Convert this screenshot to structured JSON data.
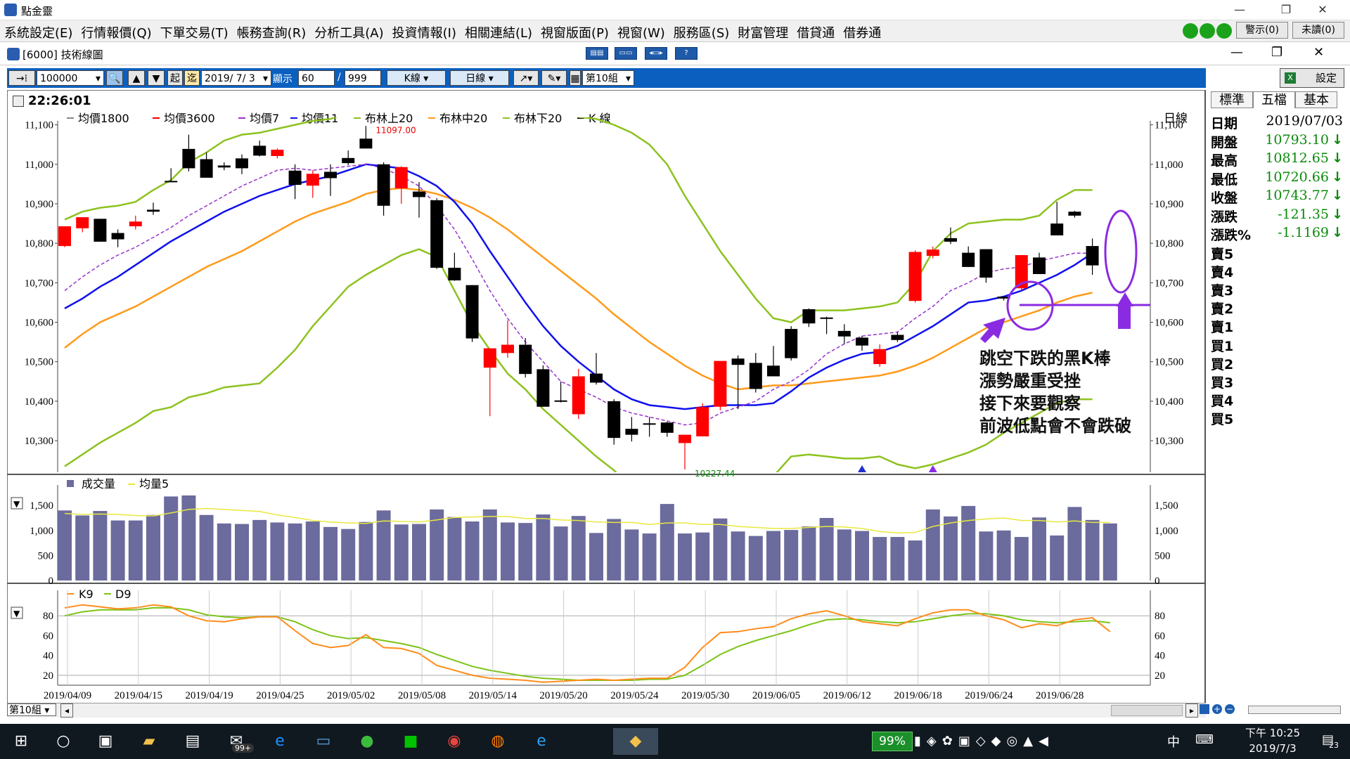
{
  "window": {
    "title": "點金靈",
    "controls": [
      "—",
      "❐",
      "✕"
    ]
  },
  "menu": {
    "items": [
      "系統設定(E)",
      "行情報價(Q)",
      "下單交易(T)",
      "帳務查詢(R)",
      "分析工具(A)",
      "投資情報(I)",
      "相關連結(L)",
      "視窗版面(P)",
      "視窗(W)",
      "服務區(S)",
      "財富管理",
      "借貸通",
      "借券通"
    ],
    "alert_btn": "警示(0)",
    "unread_btn": "未讀(0)"
  },
  "subwindow": {
    "title": "[6000] 技術線圖"
  },
  "toolbar": {
    "symbol": "100000",
    "start_label": "起",
    "end_label": "迄",
    "date": "2019/ 7/ 3",
    "show_label": "顯示",
    "show_count": "60",
    "max_count": "999",
    "kline_btn": "K線",
    "period_btn": "日線",
    "group_select": "第10組",
    "settings_btn": "設定"
  },
  "chart": {
    "time": "22:26:01",
    "period_label": "日線",
    "legend": [
      "均價1800",
      "均價3600",
      "均價7",
      "均價11",
      "布林上20",
      "布林中20",
      "布林下20",
      "K 線"
    ],
    "high_label": "11097.00",
    "low_label": "10227.44",
    "y_ticks": [
      "11,100",
      "11,000",
      "10,900",
      "10,800",
      "10,700",
      "10,600",
      "10,500",
      "10,400",
      "10,300"
    ],
    "vol_legend": [
      "成交量",
      "均量5"
    ],
    "vol_ticks": [
      "1,500",
      "1,000",
      "500",
      "0"
    ],
    "kd_legend": [
      "K9",
      "D9"
    ],
    "kd_ticks": [
      "80",
      "60",
      "40",
      "20"
    ],
    "x_labels": [
      "2019/04/09",
      "2019/04/15",
      "2019/04/19",
      "2019/04/25",
      "2019/05/02",
      "2019/05/08",
      "2019/05/14",
      "2019/05/20",
      "2019/05/24",
      "2019/05/30",
      "2019/06/05",
      "2019/06/12",
      "2019/06/18",
      "2019/06/24",
      "2019/06/28"
    ],
    "group_bottom": "第10組"
  },
  "annotation": [
    "跳空下跌的黑K棒",
    "漲勢嚴重受挫",
    "接下來要觀察",
    "前波低點會不會跌破"
  ],
  "chart_data": {
    "type": "candlestick",
    "colors": {
      "up": "#ff0000",
      "down": "#000000",
      "ma7": "#9933cc",
      "ma11": "#1010ee",
      "boll_mid": "#ff9a1a",
      "boll_band": "#8dc21f",
      "volume": "#6b6b9e",
      "vol_avg": "#e8e840",
      "k9": "#ff8c1a",
      "d9": "#7cc417"
    },
    "ohlc": [
      [
        10793,
        10812,
        10790,
        10843
      ],
      [
        10838,
        10852,
        10828,
        10866
      ],
      [
        10862,
        10855,
        10808,
        10804
      ],
      [
        10826,
        10835,
        10790,
        10810
      ],
      [
        10843,
        10870,
        10835,
        10855
      ],
      [
        10885,
        10903,
        10872,
        10880
      ],
      [
        10958,
        10990,
        10955,
        10955
      ],
      [
        11039,
        11075,
        10982,
        10990
      ],
      [
        11013,
        11030,
        10978,
        10966
      ],
      [
        10997,
        11005,
        10985,
        10992
      ],
      [
        11015,
        11025,
        10975,
        10990
      ],
      [
        11047,
        11060,
        11020,
        11022
      ],
      [
        11021,
        11040,
        11015,
        11037
      ],
      [
        10984,
        11000,
        10912,
        10948
      ],
      [
        10946,
        10985,
        10915,
        10976
      ],
      [
        10981,
        11000,
        10920,
        10965
      ],
      [
        11016,
        11035,
        10998,
        11003
      ],
      [
        11065,
        11097,
        11040,
        11040
      ],
      [
        11000,
        11005,
        10870,
        10895
      ],
      [
        10939,
        10995,
        10900,
        10993
      ],
      [
        10931,
        10955,
        10865,
        10917
      ],
      [
        10909,
        10914,
        10735,
        10738
      ],
      [
        10738,
        10776,
        10705,
        10706
      ],
      [
        10694,
        10694,
        10550,
        10559
      ],
      [
        10485,
        10525,
        10362,
        10534
      ],
      [
        10522,
        10605,
        10510,
        10543
      ],
      [
        10543,
        10560,
        10460,
        10469
      ],
      [
        10481,
        10491,
        10386,
        10386
      ],
      [
        10402,
        10450,
        10397,
        10399
      ],
      [
        10367,
        10482,
        10355,
        10463
      ],
      [
        10470,
        10522,
        10442,
        10447
      ],
      [
        10400,
        10405,
        10290,
        10307
      ],
      [
        10330,
        10360,
        10298,
        10315
      ],
      [
        10344,
        10360,
        10310,
        10343
      ],
      [
        10346,
        10348,
        10310,
        10320
      ],
      [
        10294,
        10305,
        10227,
        10315
      ],
      [
        10311,
        10395,
        10311,
        10385
      ],
      [
        10386,
        10498,
        10377,
        10502
      ],
      [
        10508,
        10516,
        10380,
        10492
      ],
      [
        10497,
        10522,
        10422,
        10431
      ],
      [
        10490,
        10540,
        10475,
        10463
      ],
      [
        10583,
        10590,
        10503,
        10509
      ],
      [
        10633,
        10635,
        10588,
        10597
      ],
      [
        10612,
        10614,
        10570,
        10609
      ],
      [
        10578,
        10595,
        10545,
        10564
      ],
      [
        10561,
        10565,
        10528,
        10541
      ],
      [
        10494,
        10544,
        10487,
        10532
      ],
      [
        10568,
        10575,
        10550,
        10555
      ],
      [
        10654,
        10782,
        10650,
        10778
      ],
      [
        10768,
        10792,
        10762,
        10784
      ],
      [
        10813,
        10840,
        10798,
        10804
      ],
      [
        10776,
        10792,
        10740,
        10740
      ],
      [
        10785,
        10785,
        10700,
        10713
      ],
      [
        10665,
        10665,
        10655,
        10660
      ],
      [
        10686,
        10768,
        10680,
        10770
      ],
      [
        10764,
        10776,
        10724,
        10722
      ],
      [
        10850,
        10905,
        10823,
        10820
      ],
      [
        10880,
        10882,
        10865,
        10870
      ],
      [
        10793,
        10812,
        10720,
        10744
      ]
    ],
    "ma7": [
      10680,
      10715,
      10745,
      10770,
      10790,
      10815,
      10840,
      10870,
      10895,
      10920,
      10945,
      10965,
      10985,
      10990,
      10985,
      10990,
      10995,
      11000,
      10990,
      10970,
      10945,
      10895,
      10835,
      10760,
      10680,
      10610,
      10550,
      10500,
      10450,
      10430,
      10410,
      10385,
      10370,
      10360,
      10350,
      10340,
      10345,
      10370,
      10385,
      10400,
      10430,
      10450,
      10480,
      10520,
      10545,
      10565,
      10570,
      10575,
      10610,
      10640,
      10680,
      10700,
      10725,
      10735,
      10740,
      10755,
      10765,
      10775,
      10775
    ],
    "ma11": [
      10635,
      10660,
      10690,
      10715,
      10745,
      10775,
      10805,
      10830,
      10855,
      10880,
      10900,
      10920,
      10935,
      10950,
      10960,
      10970,
      10985,
      11000,
      10995,
      10990,
      10970,
      10945,
      10905,
      10850,
      10780,
      10715,
      10650,
      10590,
      10540,
      10500,
      10465,
      10430,
      10405,
      10390,
      10385,
      10380,
      10385,
      10390,
      10390,
      10390,
      10395,
      10425,
      10460,
      10485,
      10505,
      10520,
      10525,
      10540,
      10565,
      10590,
      10620,
      10650,
      10655,
      10665,
      10680,
      10700,
      10720,
      10745,
      10775
    ],
    "boll_mid": [
      10535,
      10570,
      10600,
      10620,
      10640,
      10665,
      10690,
      10715,
      10740,
      10760,
      10780,
      10805,
      10830,
      10855,
      10875,
      10890,
      10905,
      10925,
      10935,
      10940,
      10935,
      10925,
      10910,
      10890,
      10865,
      10835,
      10800,
      10765,
      10730,
      10695,
      10660,
      10620,
      10585,
      10550,
      10520,
      10490,
      10465,
      10445,
      10430,
      10435,
      10440,
      10440,
      10445,
      10450,
      10455,
      10460,
      10465,
      10475,
      10490,
      10510,
      10535,
      10560,
      10585,
      10600,
      10615,
      10630,
      10650,
      10665,
      10675
    ],
    "boll_upper": [
      10860,
      10880,
      10890,
      10895,
      10905,
      10935,
      10960,
      11005,
      11030,
      11060,
      11075,
      11080,
      11090,
      11100,
      11110,
      11115,
      11130,
      11165,
      11180,
      11190,
      11200,
      11210,
      11210,
      11200,
      11185,
      11175,
      11160,
      11145,
      11130,
      11120,
      11115,
      11100,
      11080,
      11050,
      11000,
      10920,
      10850,
      10780,
      10720,
      10660,
      10610,
      10600,
      10630,
      10630,
      10630,
      10635,
      10640,
      10650,
      10700,
      10780,
      10825,
      10850,
      10855,
      10860,
      10860,
      10870,
      10910,
      10935,
      10935
    ],
    "boll_lower": [
      10235,
      10265,
      10295,
      10320,
      10345,
      10375,
      10385,
      10410,
      10420,
      10435,
      10440,
      10445,
      10485,
      10530,
      10590,
      10640,
      10690,
      10720,
      10745,
      10770,
      10785,
      10765,
      10680,
      10595,
      10530,
      10470,
      10430,
      10380,
      10340,
      10300,
      10260,
      10225,
      10180,
      10120,
      10060,
      10010,
      10030,
      10080,
      10130,
      10170,
      10210,
      10260,
      10265,
      10260,
      10255,
      10255,
      10260,
      10240,
      10230,
      10240,
      10255,
      10270,
      10290,
      10320,
      10345,
      10370,
      10395,
      10405,
      10405
    ],
    "volume": [
      1400,
      1300,
      1390,
      1200,
      1200,
      1310,
      1680,
      1700,
      1310,
      1140,
      1130,
      1210,
      1160,
      1140,
      1180,
      1070,
      1030,
      1170,
      1400,
      1120,
      1130,
      1420,
      1270,
      1180,
      1420,
      1160,
      1150,
      1320,
      1080,
      1290,
      950,
      1230,
      1020,
      940,
      1530,
      940,
      960,
      1240,
      980,
      890,
      990,
      1010,
      1080,
      1250,
      1020,
      990,
      870,
      870,
      800,
      1420,
      1280,
      1490,
      980,
      1000,
      870,
      1260,
      900,
      1470,
      1210,
      1140
    ],
    "vol_avg": [
      1340,
      1320,
      1330,
      1320,
      1300,
      1290,
      1350,
      1420,
      1440,
      1420,
      1400,
      1380,
      1310,
      1260,
      1200,
      1170,
      1150,
      1140,
      1190,
      1180,
      1170,
      1210,
      1260,
      1270,
      1280,
      1280,
      1240,
      1240,
      1210,
      1200,
      1170,
      1160,
      1160,
      1120,
      1150,
      1150,
      1120,
      1120,
      1080,
      1060,
      1040,
      1040,
      1060,
      1080,
      1070,
      1040,
      980,
      950,
      960,
      1080,
      1150,
      1200,
      1230,
      1250,
      1200,
      1200,
      1170,
      1190,
      1160,
      1160
    ],
    "k9": [
      88,
      91,
      89,
      87,
      88,
      91,
      89,
      80,
      75,
      74,
      77,
      79,
      79,
      65,
      52,
      48,
      50,
      61,
      48,
      47,
      42,
      30,
      25,
      20,
      17,
      16,
      15,
      13,
      14,
      15,
      16,
      15,
      16,
      17,
      17,
      28,
      48,
      63,
      64,
      67,
      69,
      77,
      82,
      85,
      80,
      74,
      72,
      70,
      77,
      83,
      86,
      86,
      80,
      76,
      68,
      72,
      70,
      76,
      78,
      64
    ],
    "d9": [
      80,
      84,
      86,
      86,
      86,
      88,
      88,
      86,
      81,
      79,
      78,
      79,
      79,
      74,
      66,
      60,
      57,
      58,
      55,
      52,
      48,
      41,
      35,
      29,
      25,
      22,
      19,
      17,
      16,
      15,
      15,
      15,
      15,
      16,
      16,
      20,
      30,
      41,
      49,
      55,
      60,
      65,
      71,
      76,
      77,
      76,
      74,
      73,
      74,
      77,
      80,
      82,
      82,
      80,
      76,
      74,
      73,
      74,
      75,
      73
    ],
    "price_range": [
      10220,
      11110
    ],
    "volume_range": [
      0,
      1700
    ],
    "kd_range": [
      10,
      100
    ]
  },
  "quote": {
    "tabs": [
      "標準",
      "五檔",
      "基本"
    ],
    "rows": [
      {
        "label": "日期",
        "value": "2019/07/03",
        "arrow": ""
      },
      {
        "label": "開盤",
        "value": "10793.10",
        "arrow": "↓"
      },
      {
        "label": "最高",
        "value": "10812.65",
        "arrow": "↓"
      },
      {
        "label": "最低",
        "value": "10720.66",
        "arrow": "↓"
      },
      {
        "label": "收盤",
        "value": "10743.77",
        "arrow": "↓"
      },
      {
        "label": "漲跌",
        "value": "-121.35",
        "arrow": "↓"
      },
      {
        "label": "漲跌%",
        "value": "-1.1169",
        "arrow": "↓"
      }
    ],
    "book": [
      "賣5",
      "賣4",
      "賣3",
      "賣2",
      "賣1",
      "買1",
      "買2",
      "買3",
      "買4",
      "買5"
    ]
  },
  "taskbar": {
    "battery": "99%",
    "ime": "中",
    "time": "下午 10:25",
    "date": "2019/7/3",
    "notifications": "23",
    "mail_badge": "99+"
  }
}
